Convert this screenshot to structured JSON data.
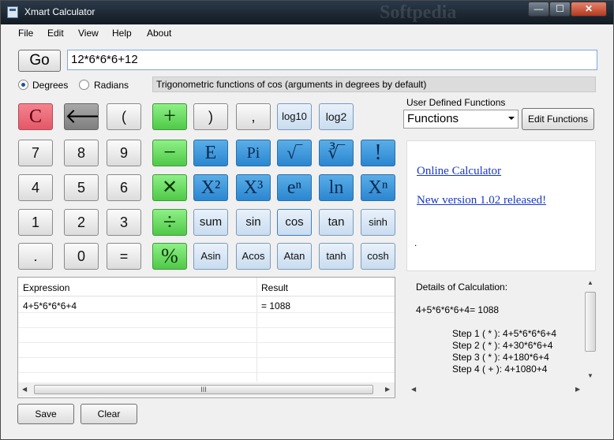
{
  "window": {
    "title": "Xmart Calculator",
    "watermark": "Softpedia",
    "min": "—",
    "max": "☐",
    "close": "✕"
  },
  "menu": [
    "File",
    "Edit",
    "View",
    "Help",
    "About"
  ],
  "go_label": "Go",
  "expression": "12*6*6*6+12",
  "angle": {
    "degrees": "Degrees",
    "radians": "Radians",
    "selected": "degrees"
  },
  "info_text": "Trigonometric functions of cos (arguments in degrees by default)",
  "buttons": {
    "clear": "C",
    "backspace": "🡐",
    "lparen": "(",
    "plus": "+",
    "rparen": ")",
    "comma": ",",
    "log10": "log10",
    "log2": "log2",
    "d7": "7",
    "d8": "8",
    "d9": "9",
    "minus": "−",
    "e": "E",
    "pi": "Pi",
    "sqrt": "√‾",
    "cbrt": "∛‾",
    "fact": "!",
    "d4": "4",
    "d5": "5",
    "d6": "6",
    "mult": "✕",
    "x2": "X²",
    "x3": "X³",
    "en": "eⁿ",
    "ln": "ln",
    "xn": "Xⁿ",
    "d1": "1",
    "d2": "2",
    "d3": "3",
    "div": "÷",
    "sum": "sum",
    "sin": "sin",
    "cos": "cos",
    "tan": "tan",
    "sinh": "sinh",
    "dot": ".",
    "d0": "0",
    "eq": "=",
    "pct": "%",
    "asin": "Asin",
    "acos": "Acos",
    "atan": "Atan",
    "tanh": "tanh",
    "cosh": "cosh"
  },
  "udf": {
    "label": "User Defined Functions",
    "selected": "Functions",
    "edit_button": "Edit Functions"
  },
  "links": {
    "online": "Online Calculator",
    "version": "New version 1.02 released!",
    "dot": "."
  },
  "history": {
    "columns": [
      "Expression",
      "Result"
    ],
    "rows": [
      {
        "expression": "4+5*6*6*6+4",
        "result": "= 1088"
      }
    ],
    "scroll_thumb": "III"
  },
  "details": {
    "title": "Details of Calculation:",
    "summary": "4+5*6*6*6+4= 1088",
    "steps": [
      "Step 1 ( * ): 4+5*6*6*6+4",
      "Step 2 ( * ): 4+30*6*6+4",
      "Step 3 ( * ): 4+180*6+4",
      "Step 4 ( + ): 4+1080+4"
    ]
  },
  "footer": {
    "save": "Save",
    "clear": "Clear"
  }
}
